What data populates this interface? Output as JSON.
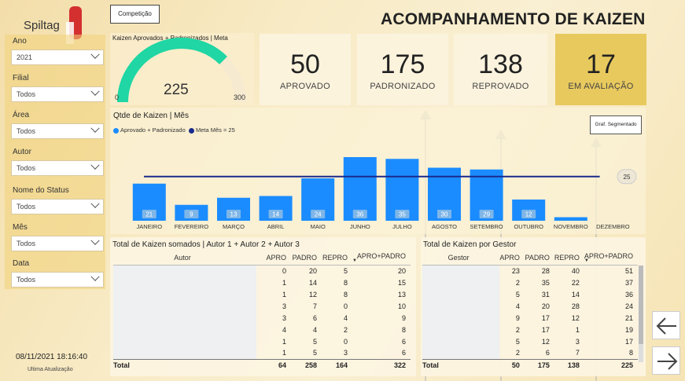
{
  "brand": "Spiltag",
  "title": "ACOMPANHAMENTO DE KAIZEN",
  "competicao_button": "Competição",
  "filters": [
    {
      "label": "Ano",
      "value": "2021"
    },
    {
      "label": "Filial",
      "value": "Todos"
    },
    {
      "label": "Área",
      "value": "Todos"
    },
    {
      "label": "Autor",
      "value": "Todos"
    },
    {
      "label": "Nome do Status",
      "value": "Todos"
    },
    {
      "label": "Mês",
      "value": "Todos"
    },
    {
      "label": "Data",
      "value": "Todos"
    }
  ],
  "timestamp": "08/11/2021 18:16:40",
  "timestamp_label": "Ultima Atualização",
  "gauge": {
    "title": "Kaizen Aprovados + Padronizados | Meta",
    "value": "225",
    "min": "0",
    "max": "300",
    "value_num": 225,
    "max_num": 300,
    "color": "#1fd6a4"
  },
  "kpis": [
    {
      "value": "50",
      "label": "APROVADO"
    },
    {
      "value": "175",
      "label": "PADRONIZADO"
    },
    {
      "value": "138",
      "label": "REPROVADO"
    },
    {
      "value": "17",
      "label": "EM AVALIAÇÃO"
    }
  ],
  "chart": {
    "title": "Qtde de Kaizen | Mês",
    "legend_series": "Aprovado + Padronizado",
    "legend_meta": "Meta Mês = 25",
    "segment_button": "Graf. Segmentado",
    "meta_label": "25"
  },
  "chart_data": {
    "type": "bar",
    "title": "Qtde de Kaizen | Mês",
    "categories": [
      "JANEIRO",
      "FEVEREIRO",
      "MARÇO",
      "ABRIL",
      "MAIO",
      "JUNHO",
      "JULHO",
      "AGOSTO",
      "SETEMBRO",
      "OUTUBRO",
      "NOVEMBRO",
      "DEZEMBRO"
    ],
    "series": [
      {
        "name": "Aprovado + Padronizado",
        "values": [
          21,
          9,
          13,
          14,
          24,
          36,
          35,
          30,
          29,
          12,
          2,
          0
        ],
        "color": "#1a8cff"
      }
    ],
    "labels": [
      "21",
      "9",
      "13",
      "14",
      "24",
      "36",
      "35",
      "30",
      "29",
      "12",
      "",
      ""
    ],
    "meta": {
      "name": "Meta Mês = 25",
      "value": 25,
      "color": "#1a2a8c"
    },
    "ylim": [
      0,
      40
    ]
  },
  "table1": {
    "title": "Total de Kaizen somados | Autor 1 + Autor 2 + Autor 3",
    "headers": [
      "Autor",
      "APRO",
      "PADRO",
      "REPRO",
      "APRO+PADRO"
    ],
    "rows": [
      [
        "",
        "0",
        "20",
        "5",
        "20"
      ],
      [
        "",
        "1",
        "14",
        "8",
        "15"
      ],
      [
        "",
        "1",
        "12",
        "8",
        "13"
      ],
      [
        "",
        "3",
        "7",
        "0",
        "10"
      ],
      [
        "",
        "3",
        "6",
        "4",
        "9"
      ],
      [
        "",
        "4",
        "4",
        "2",
        "8"
      ],
      [
        "",
        "1",
        "5",
        "0",
        "6"
      ],
      [
        "",
        "1",
        "5",
        "3",
        "6"
      ]
    ],
    "total": [
      "Total",
      "64",
      "258",
      "164",
      "322"
    ]
  },
  "table2": {
    "title": "Total de Kaizen por Gestor",
    "headers": [
      "Gestor",
      "APRO",
      "PADRO",
      "REPRO",
      "APRO+PADRO"
    ],
    "rows": [
      [
        "",
        "23",
        "28",
        "40",
        "51"
      ],
      [
        "",
        "2",
        "35",
        "22",
        "37"
      ],
      [
        "",
        "5",
        "31",
        "14",
        "36"
      ],
      [
        "",
        "4",
        "20",
        "28",
        "24"
      ],
      [
        "",
        "9",
        "17",
        "12",
        "21"
      ],
      [
        "",
        "2",
        "17",
        "1",
        "19"
      ],
      [
        "",
        "5",
        "12",
        "3",
        "17"
      ],
      [
        "",
        "2",
        "6",
        "7",
        "8"
      ]
    ],
    "total": [
      "Total",
      "50",
      "175",
      "138",
      "225"
    ]
  },
  "icons": [
    "arrow-left-icon",
    "arrow-right-icon",
    "chevron-down-icon"
  ]
}
